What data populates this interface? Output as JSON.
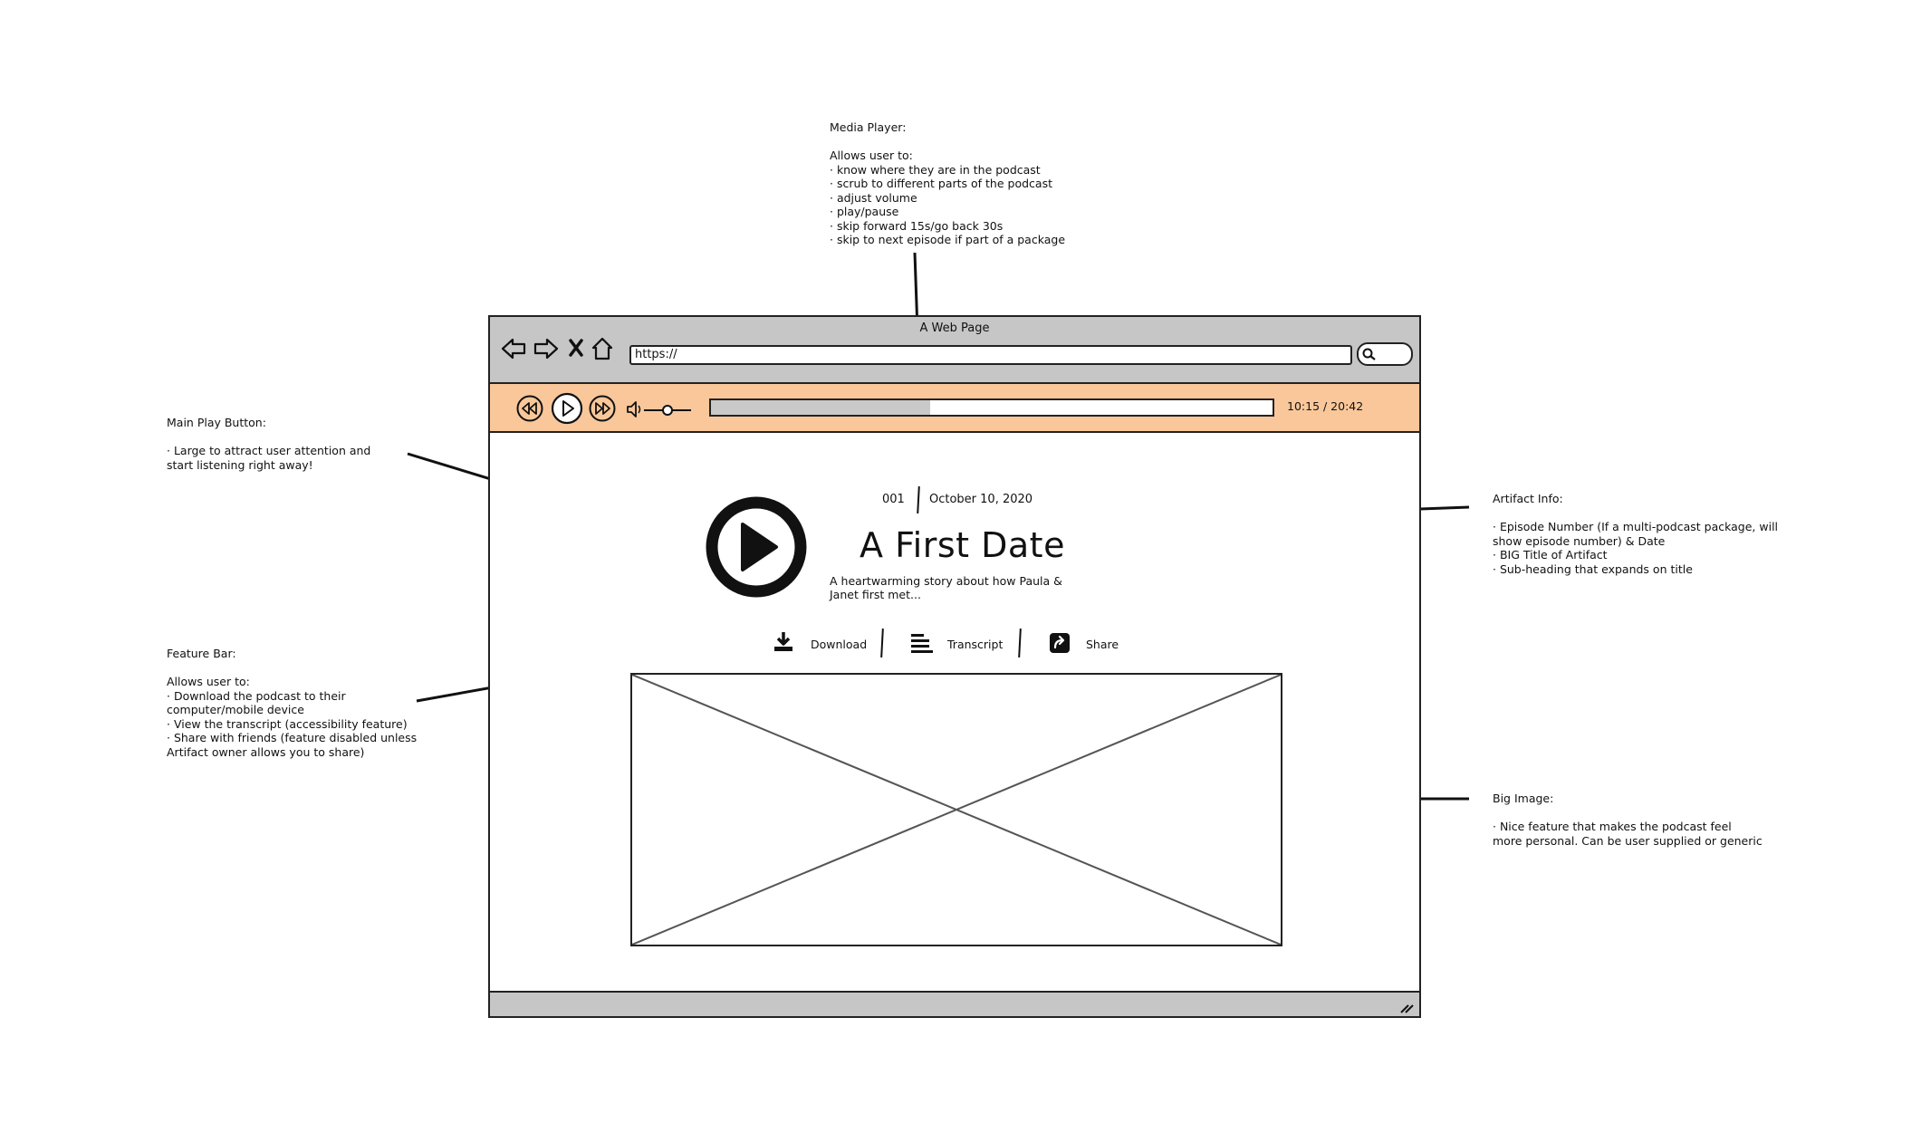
{
  "annotations": {
    "media_player": {
      "title": "Media Player:",
      "body": "Allows user to:\n· know where they are in the podcast\n· scrub to different parts of the podcast\n· adjust volume\n· play/pause\n· skip forward 15s/go back 30s\n· skip to next episode if part of a package"
    },
    "main_play": {
      "title": "Main Play Button:",
      "body": "· Large to attract user attention and start listening right away!"
    },
    "feature_bar": {
      "title": "Feature Bar:",
      "body": "Allows user to:\n· Download the podcast to their computer/mobile device\n· View the transcript (accessibility feature)\n· Share with friends (feature disabled unless Artifact owner allows you to share)"
    },
    "artifact_info": {
      "title": "Artifact Info:",
      "body": "· Episode Number (If a multi-podcast package, will show episode number) & Date\n· BIG Title of Artifact\n· Sub-heading that expands on title"
    },
    "big_image": {
      "title": "Big Image:",
      "body": "· Nice feature that makes the podcast feel more personal. Can be user supplied or generic"
    }
  },
  "browser": {
    "title": "A Web Page",
    "url": "https://",
    "icons": [
      "back-icon",
      "forward-icon",
      "stop-icon",
      "home-icon",
      "search-icon"
    ]
  },
  "player": {
    "time": "10:15 / 20:42",
    "progress": 0.39,
    "volume": 0.5,
    "background": "#f9c79a"
  },
  "episode": {
    "number": "001",
    "date": "October 10, 2020",
    "title": "A First Date",
    "subheading": "A heartwarming story about how Paula & Janet first met..."
  },
  "features": {
    "download": "Download",
    "transcript": "Transcript",
    "share": "Share"
  },
  "colors": {
    "chrome": "#c6c6c6",
    "player_bg": "#f9c79a",
    "ink": "#111111"
  }
}
